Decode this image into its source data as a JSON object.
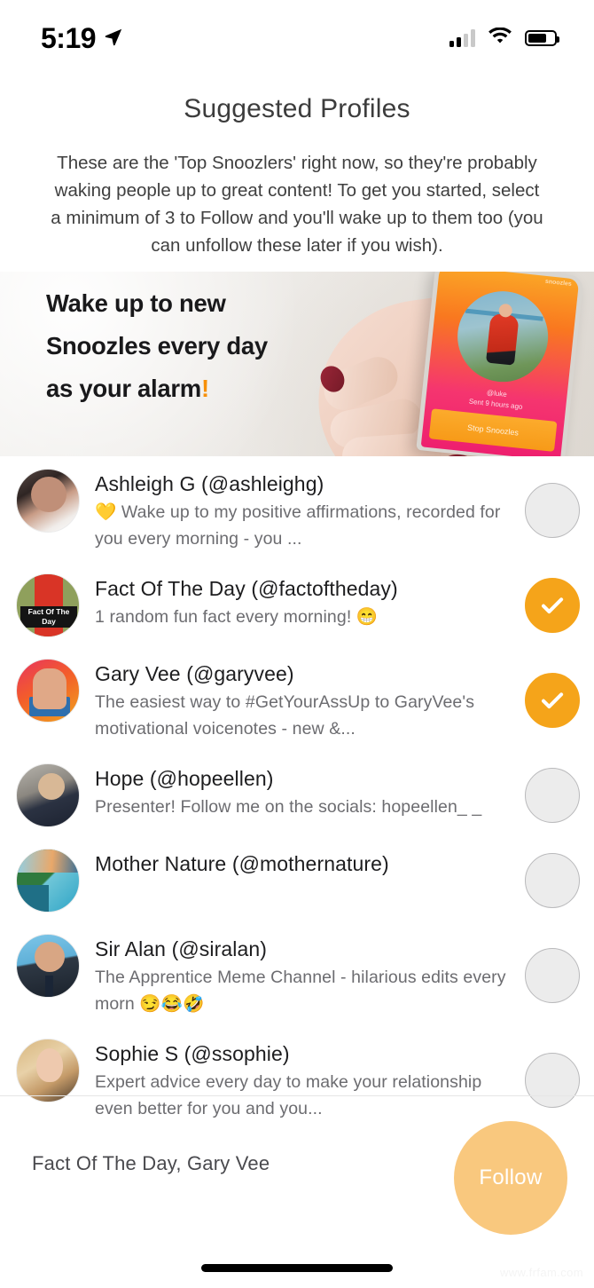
{
  "status_bar": {
    "time": "5:19",
    "location_icon": "location-arrow-icon",
    "signal_icon": "cellular-signal-icon",
    "signal_bars_filled": 2,
    "signal_bars_total": 4,
    "wifi_icon": "wifi-icon",
    "battery_icon": "battery-icon",
    "battery_level_pct": 70
  },
  "header": {
    "title": "Suggested Profiles",
    "description": "These are the 'Top Snoozlers' right now, so they're probably waking people up to great content! To get you started, select a minimum of 3 to Follow and you'll wake up to them too (you can unfollow these later if you wish)."
  },
  "banner": {
    "line1": "Wake up to new",
    "line2": "Snoozles every day",
    "line3": "as your alarm",
    "exclaim": "!",
    "phone_mock": {
      "brand": "snoozles",
      "handle": "@luke",
      "sent": "Sent 9 hours ago",
      "button": "Stop Snoozles"
    },
    "accent_color": "#f79009"
  },
  "colors": {
    "accent_orange": "#f5a41a",
    "follow_button": "#f9c87e",
    "toggle_off_fill": "#ececec",
    "toggle_off_border": "#b9b9bb",
    "title_text": "#3c3c3c",
    "body_text": "#6c6c70"
  },
  "profiles": [
    {
      "name": "Ashleigh G",
      "handle": "(@ashleighg)",
      "description": "💛 Wake up to my positive affirmations, recorded for you every morning - you ...",
      "selected": false,
      "avatar": "avatar-ashleigh-g"
    },
    {
      "name": "Fact Of The Day",
      "handle": "(@factoftheday)",
      "description": "1 random fun fact every morning!  😁",
      "selected": true,
      "avatar": "avatar-fact-of-the-day",
      "avatar_label": "Fact Of The Day"
    },
    {
      "name": "Gary Vee",
      "handle": "(@garyvee)",
      "description": "The easiest way to #GetYourAssUp to GaryVee's motivational voicenotes - new &...",
      "selected": true,
      "avatar": "avatar-gary-vee"
    },
    {
      "name": "Hope",
      "handle": "(@hopeellen)",
      "description": "Presenter! Follow me on the socials: hopeellen_ _",
      "selected": false,
      "avatar": "avatar-hope"
    },
    {
      "name": "Mother Nature",
      "handle": "(@mothernature)",
      "description": "",
      "selected": false,
      "avatar": "avatar-mother-nature"
    },
    {
      "name": "Sir Alan",
      "handle": "(@siralan)",
      "description": "The Apprentice Meme Channel - hilarious edits every morn 😏😂🤣",
      "selected": false,
      "avatar": "avatar-sir-alan"
    },
    {
      "name": "Sophie S",
      "handle": "(@ssophie)",
      "description": "Expert advice every day to make your relationship even better for you and you...",
      "selected": false,
      "avatar": "avatar-sophie-s"
    }
  ],
  "footer": {
    "selected_summary": "Fact Of The Day, Gary Vee",
    "follow_label": "Follow",
    "watermark": "www.frfam.com"
  }
}
